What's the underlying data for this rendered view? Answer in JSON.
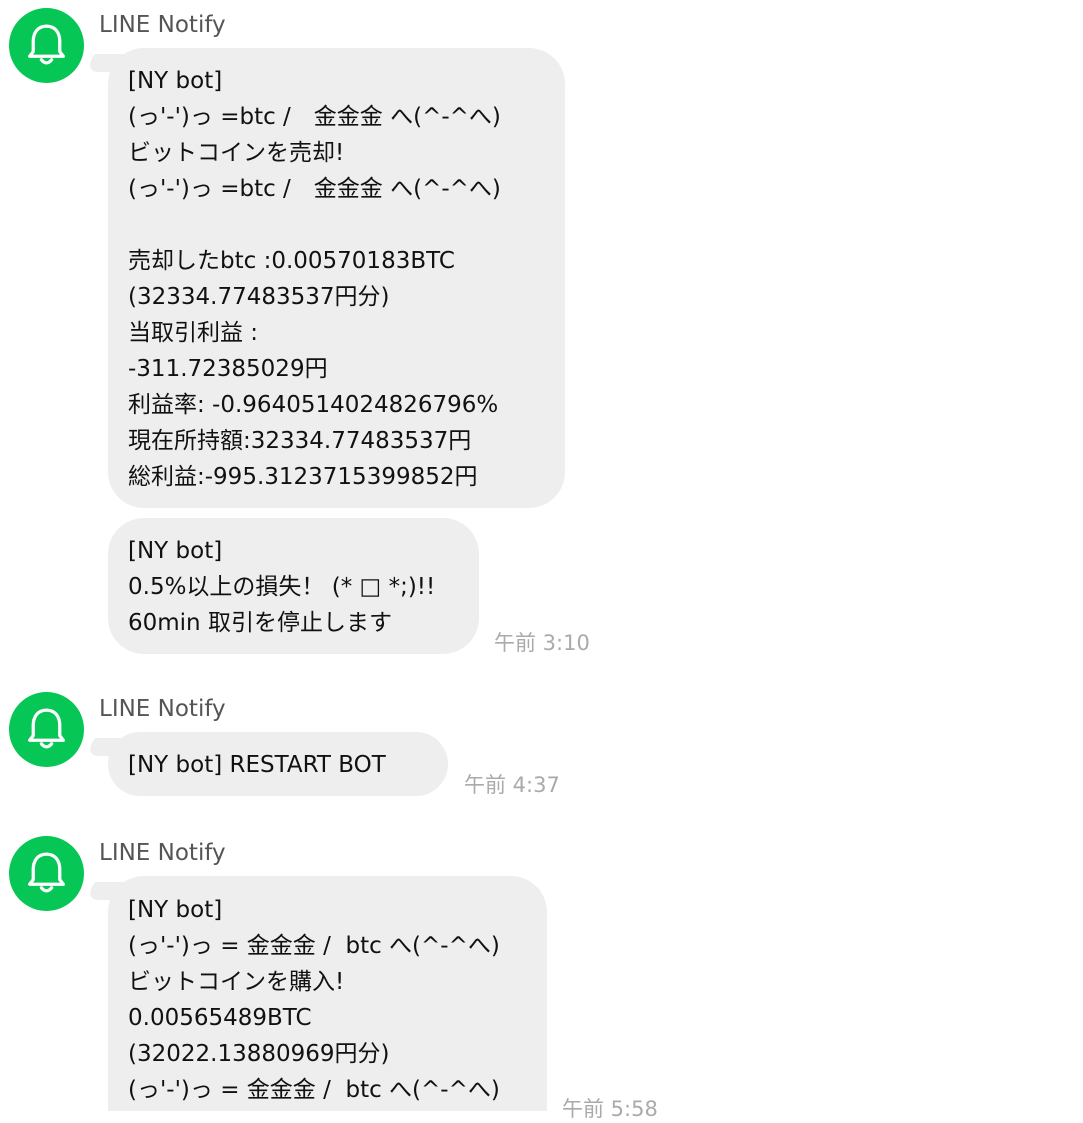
{
  "theme": {
    "avatar_color": "#06c755",
    "bubble_color": "#eeeeee",
    "timestamp_color": "#aaaaaa",
    "avatar_icon": "bell-icon"
  },
  "messages": [
    {
      "sender": "LINE Notify",
      "bubbles": [
        {
          "lines": [
            "[NY bot]",
            "(っ'-')っ =btc /　金金金 へ(^-^へ)",
            "ビットコインを売却!",
            "(っ'-')っ =btc /　金金金 へ(^-^へ)",
            "",
            "売却したbtc :0.00570183BTC",
            "(32334.77483537円分)",
            "当取引利益 :",
            "-311.72385029円",
            "利益率: -0.9640514024826796%",
            "現在所持額:32334.77483537円",
            "総利益:-995.3123715399852円"
          ]
        },
        {
          "lines": [
            "[NY bot]",
            "0.5%以上の損失！ (* □ *;)!!",
            "60min 取引を停止します"
          ],
          "time": "午前 3:10"
        }
      ]
    },
    {
      "sender": "LINE Notify",
      "bubbles": [
        {
          "lines": [
            "[NY bot] RESTART BOT"
          ],
          "time": "午前 4:37"
        }
      ]
    },
    {
      "sender": "LINE Notify",
      "bubbles": [
        {
          "lines": [
            "[NY bot]",
            "(っ'-')っ = 金金金 /  btc へ(^-^へ)",
            "ビットコインを購入!",
            "0.00565489BTC",
            "(32022.13880969円分)",
            "(っ'-')っ = 金金金 /  btc へ(^-^へ)"
          ],
          "time": "午前 5:58"
        }
      ]
    }
  ]
}
